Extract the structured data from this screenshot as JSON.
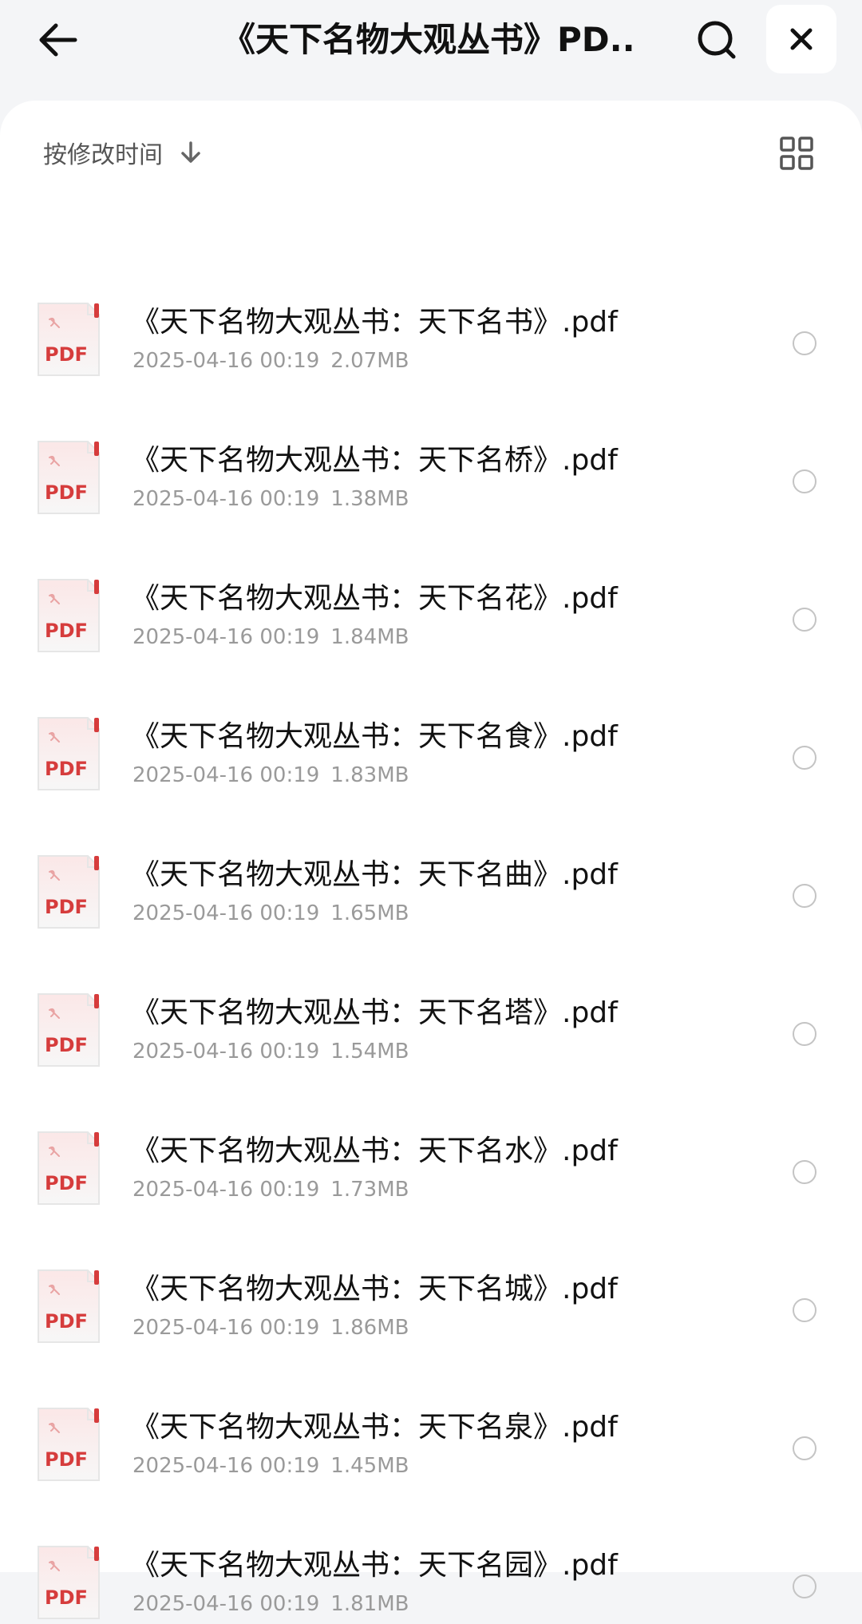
{
  "header": {
    "title": "《天下名物大观丛书》PD...",
    "back_icon": "arrow-left-icon",
    "search_icon": "search-icon",
    "close_icon": "close-icon"
  },
  "toolbar": {
    "sort_label": "按修改时间",
    "sort_icon": "arrow-down-icon",
    "view_icon": "grid-view-icon"
  },
  "files": [
    {
      "name": "《天下名物大观丛书：天下名书》.pdf",
      "date": "2025-04-16 00:19",
      "size": "2.07MB"
    },
    {
      "name": "《天下名物大观丛书：天下名桥》.pdf",
      "date": "2025-04-16 00:19",
      "size": "1.38MB"
    },
    {
      "name": "《天下名物大观丛书：天下名花》.pdf",
      "date": "2025-04-16 00:19",
      "size": "1.84MB"
    },
    {
      "name": "《天下名物大观丛书：天下名食》.pdf",
      "date": "2025-04-16 00:19",
      "size": "1.83MB"
    },
    {
      "name": "《天下名物大观丛书：天下名曲》.pdf",
      "date": "2025-04-16 00:19",
      "size": "1.65MB"
    },
    {
      "name": "《天下名物大观丛书：天下名塔》.pdf",
      "date": "2025-04-16 00:19",
      "size": "1.54MB"
    },
    {
      "name": "《天下名物大观丛书：天下名水》.pdf",
      "date": "2025-04-16 00:19",
      "size": "1.73MB"
    },
    {
      "name": "《天下名物大观丛书：天下名城》.pdf",
      "date": "2025-04-16 00:19",
      "size": "1.86MB"
    },
    {
      "name": "《天下名物大观丛书：天下名泉》.pdf",
      "date": "2025-04-16 00:19",
      "size": "1.45MB"
    },
    {
      "name": "《天下名物大观丛书：天下名园》.pdf",
      "date": "2025-04-16 00:19",
      "size": "1.81MB"
    }
  ],
  "file_icon": {
    "label": "PDF",
    "accent_color": "#d63c3c"
  }
}
